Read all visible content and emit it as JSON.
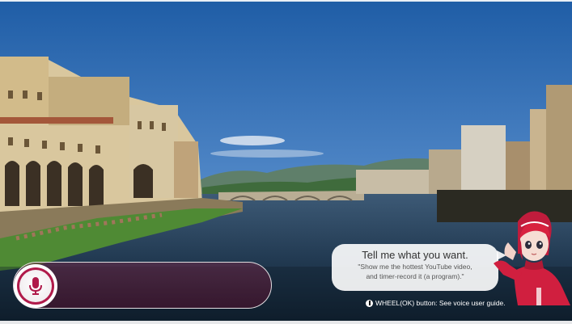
{
  "voice": {
    "prompt_title": "Tell me what you want.",
    "example_line1": "\"Show me the hottest YouTube video,",
    "example_line2": "and timer-record it (a program).\"",
    "hint": "WHEEL(OK) button: See voice user guide."
  },
  "icons": {
    "mic": "microphone-icon",
    "wheel": "wheel-button-icon"
  },
  "colors": {
    "accent": "#b01a4a",
    "panel": "#5a2040"
  }
}
